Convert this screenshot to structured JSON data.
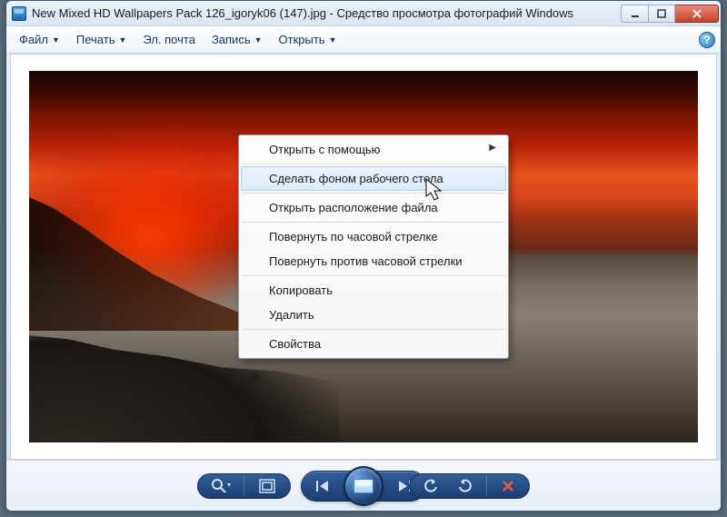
{
  "title": "New Mixed HD Wallpapers Pack 126_igoryk06 (147).jpg - Средство просмотра фотографий Windows",
  "menu": {
    "file": "Файл",
    "print": "Печать",
    "email": "Эл. почта",
    "record": "Запись",
    "open": "Открыть"
  },
  "contextMenu": {
    "openWith": "Открыть с помощью",
    "setWallpaper": "Сделать фоном рабочего стола",
    "openLocation": "Открыть расположение файла",
    "rotateCW": "Повернуть по часовой стрелке",
    "rotateCCW": "Повернуть против часовой стрелки",
    "copy": "Копировать",
    "delete": "Удалить",
    "properties": "Свойства"
  },
  "help": "?"
}
